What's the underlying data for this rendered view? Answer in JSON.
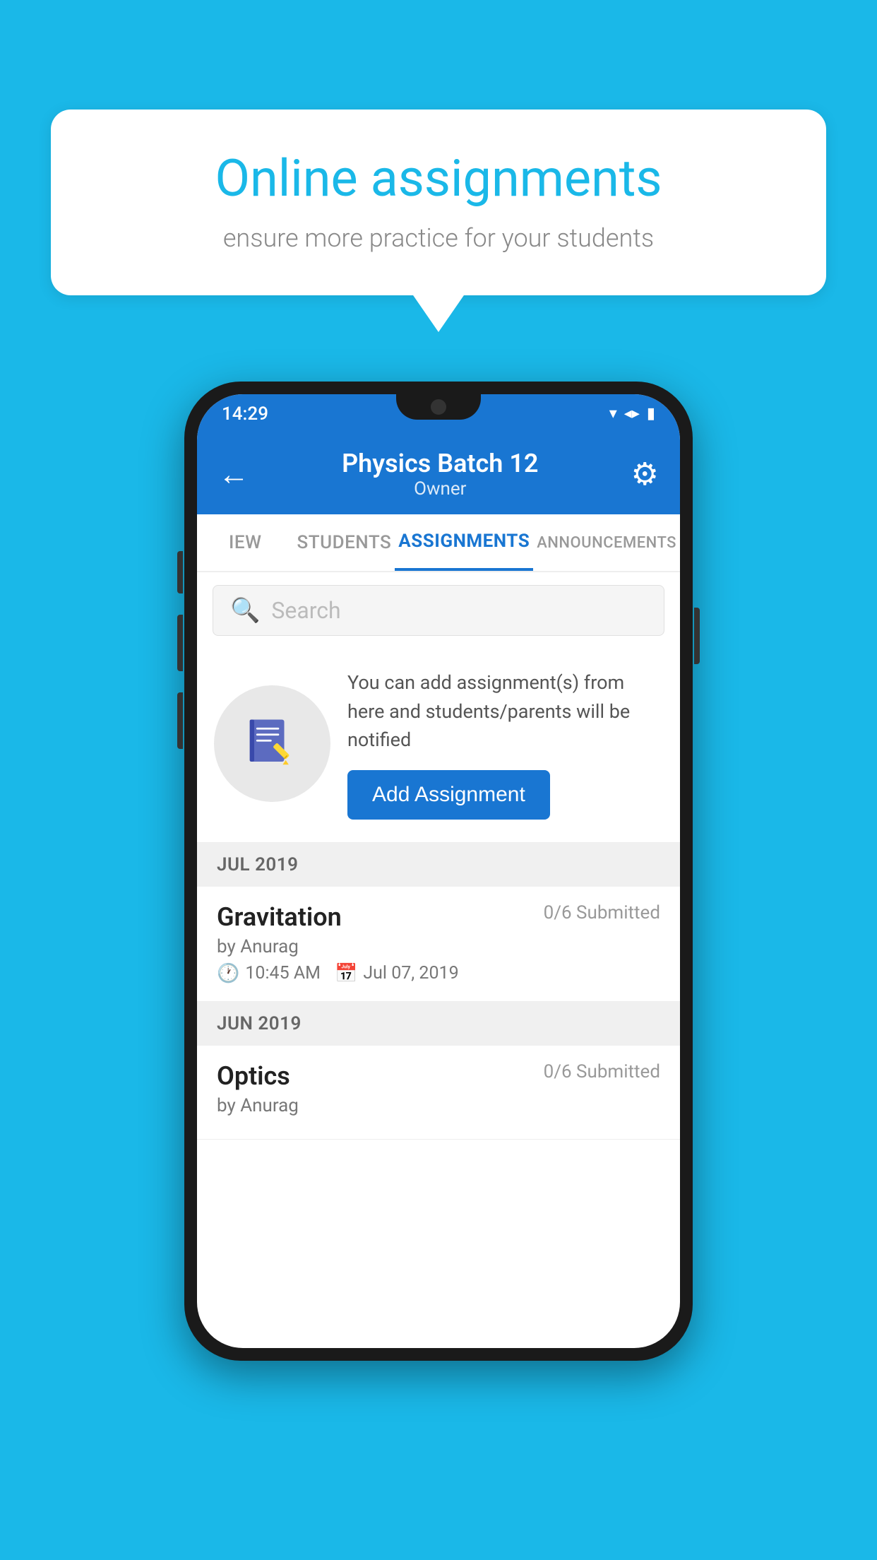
{
  "background_color": "#1ab8e8",
  "speech_bubble": {
    "title": "Online assignments",
    "subtitle": "ensure more practice for your students"
  },
  "status_bar": {
    "time": "14:29",
    "wifi_icon": "▾",
    "signal_icon": "▲",
    "battery_icon": "▮"
  },
  "header": {
    "title": "Physics Batch 12",
    "subtitle": "Owner",
    "back_label": "←",
    "gear_label": "⚙"
  },
  "tabs": [
    {
      "label": "IEW",
      "active": false
    },
    {
      "label": "STUDENTS",
      "active": false
    },
    {
      "label": "ASSIGNMENTS",
      "active": true
    },
    {
      "label": "ANNOUNCEMENTS",
      "active": false
    }
  ],
  "search": {
    "placeholder": "Search"
  },
  "promo": {
    "description": "You can add assignment(s) from here and students/parents will be notified",
    "button_label": "Add Assignment"
  },
  "sections": [
    {
      "month": "JUL 2019",
      "assignments": [
        {
          "name": "Gravitation",
          "submitted": "0/6 Submitted",
          "by": "by Anurag",
          "time": "10:45 AM",
          "date": "Jul 07, 2019"
        }
      ]
    },
    {
      "month": "JUN 2019",
      "assignments": [
        {
          "name": "Optics",
          "submitted": "0/6 Submitted",
          "by": "by Anurag",
          "time": "",
          "date": ""
        }
      ]
    }
  ]
}
